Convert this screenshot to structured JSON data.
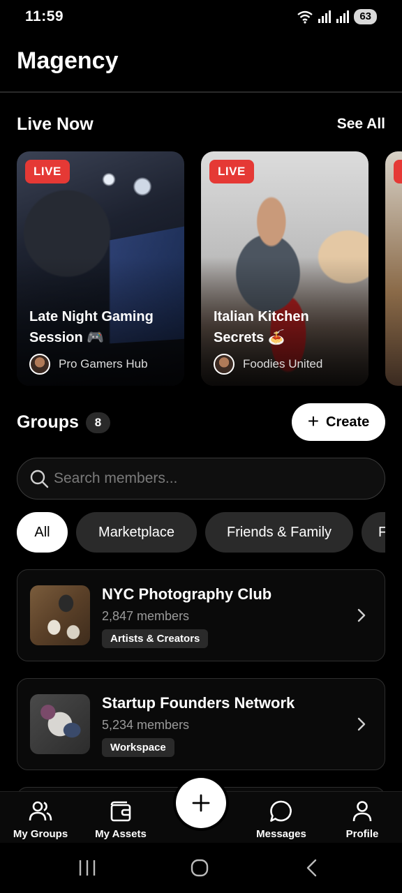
{
  "status_bar": {
    "time": "11:59",
    "battery": "63"
  },
  "header": {
    "title": "Magency"
  },
  "live": {
    "title": "Live Now",
    "see_all": "See All",
    "cards": [
      {
        "badge": "LIVE",
        "title": "Late Night Gaming Session 🎮",
        "host": "Pro Gamers Hub"
      },
      {
        "badge": "LIVE",
        "title": "Italian Kitchen Secrets 🍝",
        "host": "Foodies United"
      }
    ]
  },
  "groups": {
    "title": "Groups",
    "count": "8",
    "create_label": "Create",
    "search_placeholder": "Search members...",
    "filters": [
      "All",
      "Marketplace",
      "Friends & Family",
      "F"
    ],
    "items": [
      {
        "name": "NYC Photography Club",
        "members": "2,847 members",
        "tag": "Artists & Creators"
      },
      {
        "name": "Startup Founders Network",
        "members": "5,234 members",
        "tag": "Workspace"
      }
    ]
  },
  "bottom_nav": {
    "items": [
      {
        "label": "My Groups",
        "icon": "users-icon"
      },
      {
        "label": "My Assets",
        "icon": "wallet-icon"
      },
      {
        "label": "Messages",
        "icon": "chat-icon"
      },
      {
        "label": "Profile",
        "icon": "user-icon"
      }
    ]
  },
  "colors": {
    "live_red": "#e53935",
    "background": "#000000",
    "chip": "#2a2a2a"
  }
}
